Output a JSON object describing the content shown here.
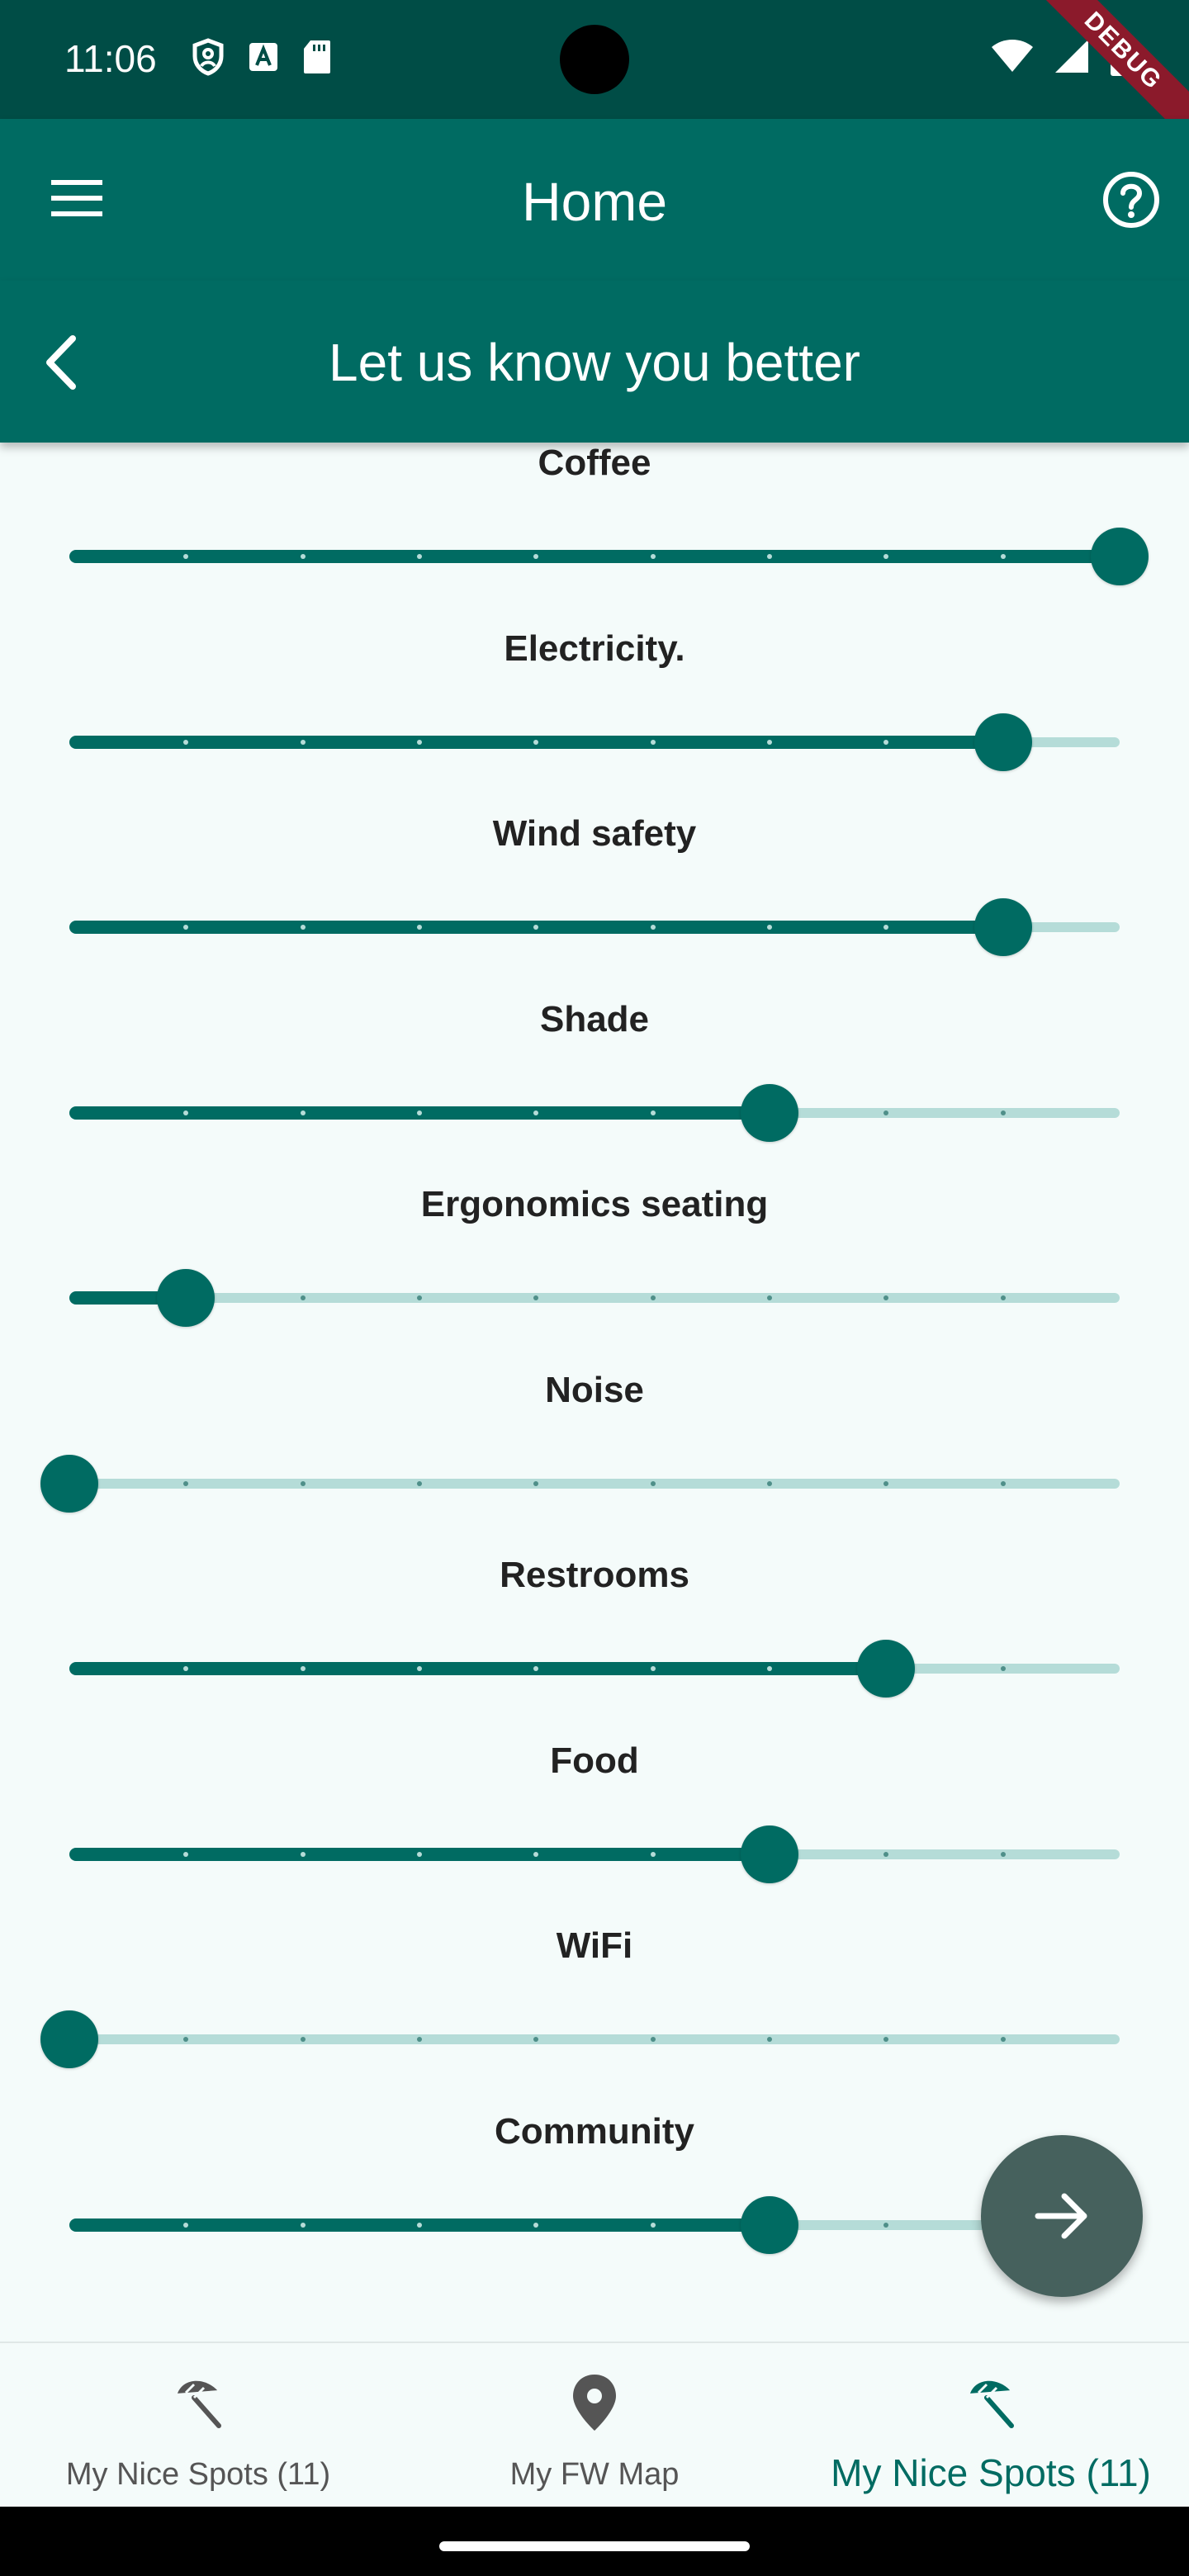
{
  "status_bar": {
    "time": "11:06",
    "debug_label": "DEBUG"
  },
  "app_bar": {
    "title": "Home"
  },
  "sub_bar": {
    "title": "Let us know you better"
  },
  "sliders": [
    {
      "label": "Coffee",
      "value": 9,
      "max": 9
    },
    {
      "label": "Electricity.",
      "value": 8,
      "max": 9
    },
    {
      "label": "Wind safety",
      "value": 8,
      "max": 9
    },
    {
      "label": "Shade",
      "value": 6,
      "max": 9
    },
    {
      "label": "Ergonomics seating",
      "value": 1,
      "max": 9
    },
    {
      "label": "Noise",
      "value": 0,
      "max": 9
    },
    {
      "label": "Restrooms",
      "value": 7,
      "max": 9
    },
    {
      "label": "Food",
      "value": 6,
      "max": 9
    },
    {
      "label": "WiFi",
      "value": 0,
      "max": 9
    },
    {
      "label": "Community",
      "value": 6,
      "max": 9
    }
  ],
  "bottom_nav": {
    "items": [
      {
        "label": "My Nice Spots (11)",
        "icon": "beach-umbrella-icon",
        "active": false
      },
      {
        "label": "My FW Map",
        "icon": "map-pin-icon",
        "active": false
      },
      {
        "label": "My Nice Spots (11)",
        "icon": "beach-umbrella-icon",
        "active": true
      }
    ]
  },
  "colors": {
    "primary": "#006b62",
    "status_bar": "#004d46",
    "track_inactive": "#b5dcd8",
    "fab": "#46615d",
    "background": "#f4fbfa"
  }
}
